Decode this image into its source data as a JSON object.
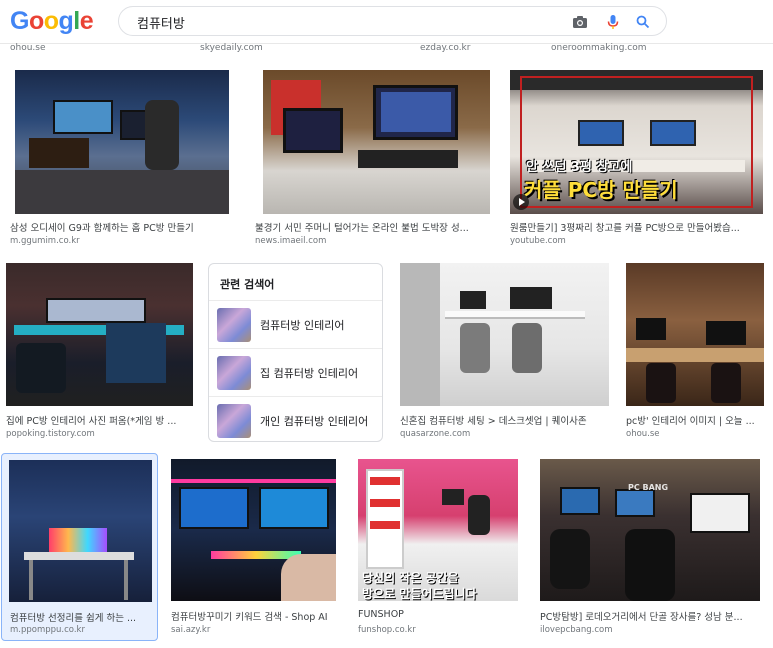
{
  "header": {
    "logo": "Google",
    "search_value": "컴퓨터방"
  },
  "top_sources": [
    "ohou.se",
    "skyedaily.com",
    "ezday.co.kr",
    "oneroommaking.com"
  ],
  "row1": [
    {
      "title": "삼성 오디세이 G9과 함께하는 홈 PC방 만들기",
      "source": "m.ggumim.co.kr"
    },
    {
      "title": "불경기 서민 주머니 털어가는 온라인 불법 도박장 성...",
      "source": "news.imaeil.com"
    },
    {
      "title": "원룸만들기] 3평짜리 창고를 커플 PC방으로 만들어봤습...",
      "source": "youtube.com",
      "overlay_line1": "안 쓰던 3평 창고에",
      "overlay_line2": "커플 PC방 만들기"
    }
  ],
  "row2": [
    {
      "title": "집에 PC방 인테리어 사진 퍼옴(*게임 방 ...",
      "source": "popoking.tistory.com"
    },
    {
      "title": "신혼집 컴퓨터방 세팅 > 데스크셋업 | 퀘이사존",
      "source": "quasarzone.com"
    },
    {
      "title": "pc방' 인테리어 이미지 | 오늘 ...",
      "source": "ohou.se"
    }
  ],
  "related": {
    "heading": "관련 검색어",
    "items": [
      "컴퓨터방 인테리어",
      "집 컴퓨터방 인테리어",
      "개인 컴퓨터방 인테리어"
    ]
  },
  "row3": [
    {
      "title": "컴퓨터방 선정리를 쉽게 하는 ...",
      "source": "m.ppomppu.co.kr"
    },
    {
      "title": "컴퓨터방꾸미기 키워드 검색 - Shop AI",
      "source": "sai.azy.kr"
    },
    {
      "title": "FUNSHOP",
      "source": "funshop.co.kr",
      "overlay_line1": "당신의 작은 공간을",
      "overlay_line2": "방으로 만들어드립니다"
    },
    {
      "title": "PC방탐방] 로데오거리에서 단골 장사를? 성남 분...",
      "source": "ilovepcbang.com",
      "overlay_logo": "PC BANG"
    }
  ],
  "colors": {
    "accent": "#1a73e8",
    "selected_border": "#8ab4f8"
  },
  "icons": [
    "camera-icon",
    "microphone-icon",
    "search-icon"
  ]
}
